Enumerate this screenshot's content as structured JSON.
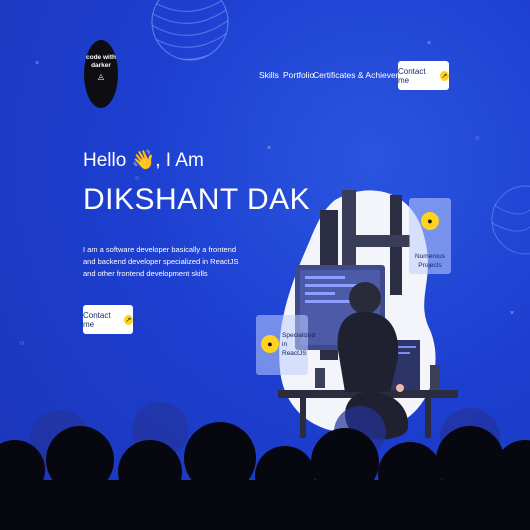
{
  "logo": {
    "line1": "code with",
    "line2": "darker"
  },
  "nav": {
    "items": [
      "Skills",
      "Portfolio",
      "Certificates & Achievements"
    ],
    "contact": "Contact me"
  },
  "hero": {
    "greeting": "Hello 👋, I Am",
    "name": "DIKSHANT DAK",
    "description": "I am a software developer basically a frontend and backend developer specialized in ReactJS and other frontend development skills",
    "cta": "Contact me"
  },
  "cards": {
    "numerous": "Numerous Projects",
    "specialized": "Specialized in ReactJS"
  },
  "colors": {
    "background": "#1d3fd0",
    "accent": "#ffd21f",
    "silhouette": "#06070f"
  }
}
